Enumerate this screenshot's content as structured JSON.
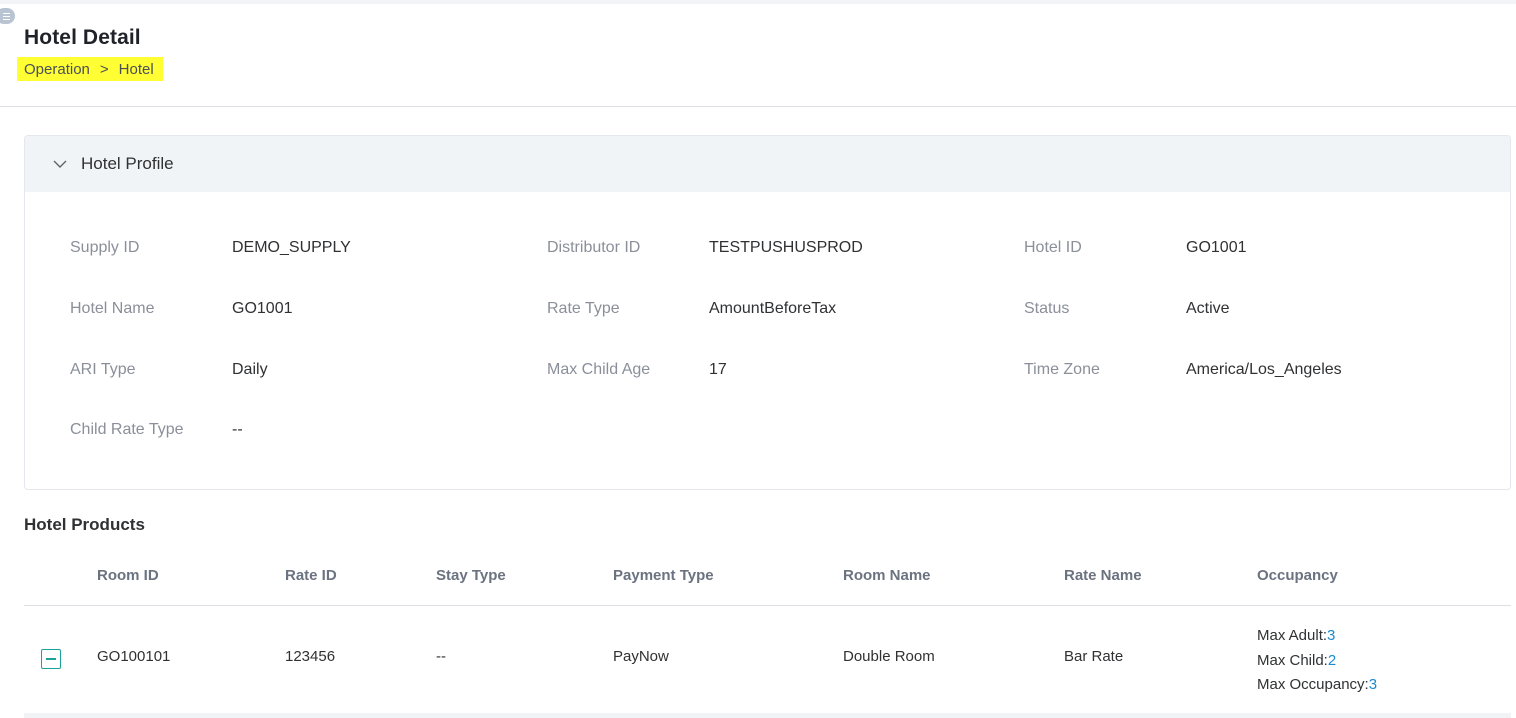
{
  "header": {
    "title": "Hotel Detail",
    "breadcrumb": [
      "Operation",
      "Hotel"
    ],
    "breadcrumb_separator": ">"
  },
  "profile": {
    "title": "Hotel Profile",
    "fields": {
      "supply_id": {
        "label": "Supply ID",
        "value": "DEMO_SUPPLY"
      },
      "distributor_id": {
        "label": "Distributor ID",
        "value": "TESTPUSHUSPROD"
      },
      "hotel_id": {
        "label": "Hotel ID",
        "value": "GO1001"
      },
      "hotel_name": {
        "label": "Hotel Name",
        "value": "GO1001"
      },
      "rate_type": {
        "label": "Rate Type",
        "value": "AmountBeforeTax"
      },
      "status": {
        "label": "Status",
        "value": "Active"
      },
      "ari_type": {
        "label": "ARI Type",
        "value": "Daily"
      },
      "max_child_age": {
        "label": "Max Child Age",
        "value": "17"
      },
      "time_zone": {
        "label": "Time Zone",
        "value": "America/Los_Angeles"
      },
      "child_rate_type": {
        "label": "Child Rate Type",
        "value": "--"
      }
    }
  },
  "products": {
    "title": "Hotel Products",
    "columns": [
      "Room ID",
      "Rate ID",
      "Stay Type",
      "Payment Type",
      "Room Name",
      "Rate Name",
      "Occupancy"
    ],
    "rows": [
      {
        "room_id": "GO100101",
        "rate_id": "123456",
        "stay_type": "--",
        "payment_type": "PayNow",
        "room_name": "Double Room",
        "rate_name": "Bar Rate",
        "occupancy": {
          "max_adult_label": "Max Adult:",
          "max_adult": "3",
          "max_child_label": "Max Child:",
          "max_child": "2",
          "max_occupancy_label": "Max Occupancy:",
          "max_occupancy": "3"
        }
      }
    ]
  },
  "colors": {
    "accent": "#1aa39a",
    "link_number": "#1b8bd1",
    "highlight": "#ffff33",
    "section_bg": "#f1f4f7"
  },
  "icons": {
    "menu_toggle": "menu-icon",
    "profile_collapse": "chevron-down-icon",
    "row_collapse": "minus-square-icon"
  }
}
